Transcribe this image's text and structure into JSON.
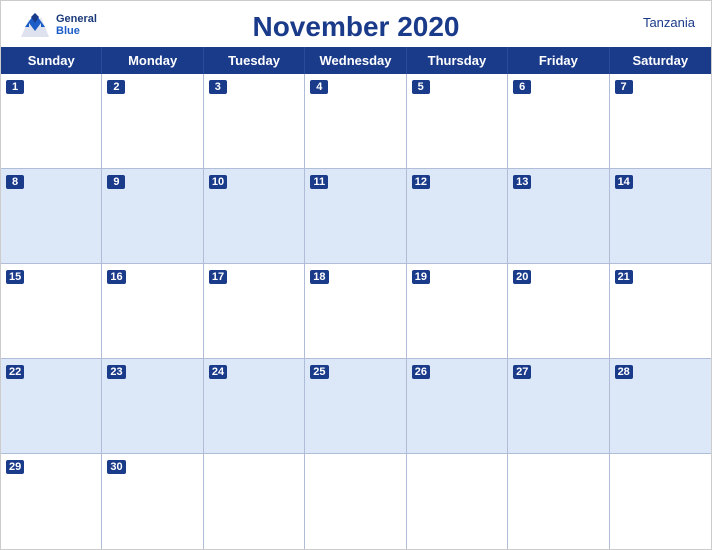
{
  "header": {
    "title": "November 2020",
    "country": "Tanzania",
    "logo_general": "General",
    "logo_blue": "Blue"
  },
  "days_of_week": [
    "Sunday",
    "Monday",
    "Tuesday",
    "Wednesday",
    "Thursday",
    "Friday",
    "Saturday"
  ],
  "weeks": [
    [
      {
        "date": "1",
        "empty": false
      },
      {
        "date": "2",
        "empty": false
      },
      {
        "date": "3",
        "empty": false
      },
      {
        "date": "4",
        "empty": false
      },
      {
        "date": "5",
        "empty": false
      },
      {
        "date": "6",
        "empty": false
      },
      {
        "date": "7",
        "empty": false
      }
    ],
    [
      {
        "date": "8",
        "empty": false
      },
      {
        "date": "9",
        "empty": false
      },
      {
        "date": "10",
        "empty": false
      },
      {
        "date": "11",
        "empty": false
      },
      {
        "date": "12",
        "empty": false
      },
      {
        "date": "13",
        "empty": false
      },
      {
        "date": "14",
        "empty": false
      }
    ],
    [
      {
        "date": "15",
        "empty": false
      },
      {
        "date": "16",
        "empty": false
      },
      {
        "date": "17",
        "empty": false
      },
      {
        "date": "18",
        "empty": false
      },
      {
        "date": "19",
        "empty": false
      },
      {
        "date": "20",
        "empty": false
      },
      {
        "date": "21",
        "empty": false
      }
    ],
    [
      {
        "date": "22",
        "empty": false
      },
      {
        "date": "23",
        "empty": false
      },
      {
        "date": "24",
        "empty": false
      },
      {
        "date": "25",
        "empty": false
      },
      {
        "date": "26",
        "empty": false
      },
      {
        "date": "27",
        "empty": false
      },
      {
        "date": "28",
        "empty": false
      }
    ],
    [
      {
        "date": "29",
        "empty": false
      },
      {
        "date": "30",
        "empty": false
      },
      {
        "date": "",
        "empty": true
      },
      {
        "date": "",
        "empty": true
      },
      {
        "date": "",
        "empty": true
      },
      {
        "date": "",
        "empty": true
      },
      {
        "date": "",
        "empty": true
      }
    ]
  ],
  "colors": {
    "header_bg": "#1a3a8a",
    "row_even_bg": "#dce8f8",
    "row_odd_bg": "#ffffff",
    "date_number_bg": "#1a3a8a",
    "date_number_color": "#ffffff"
  }
}
